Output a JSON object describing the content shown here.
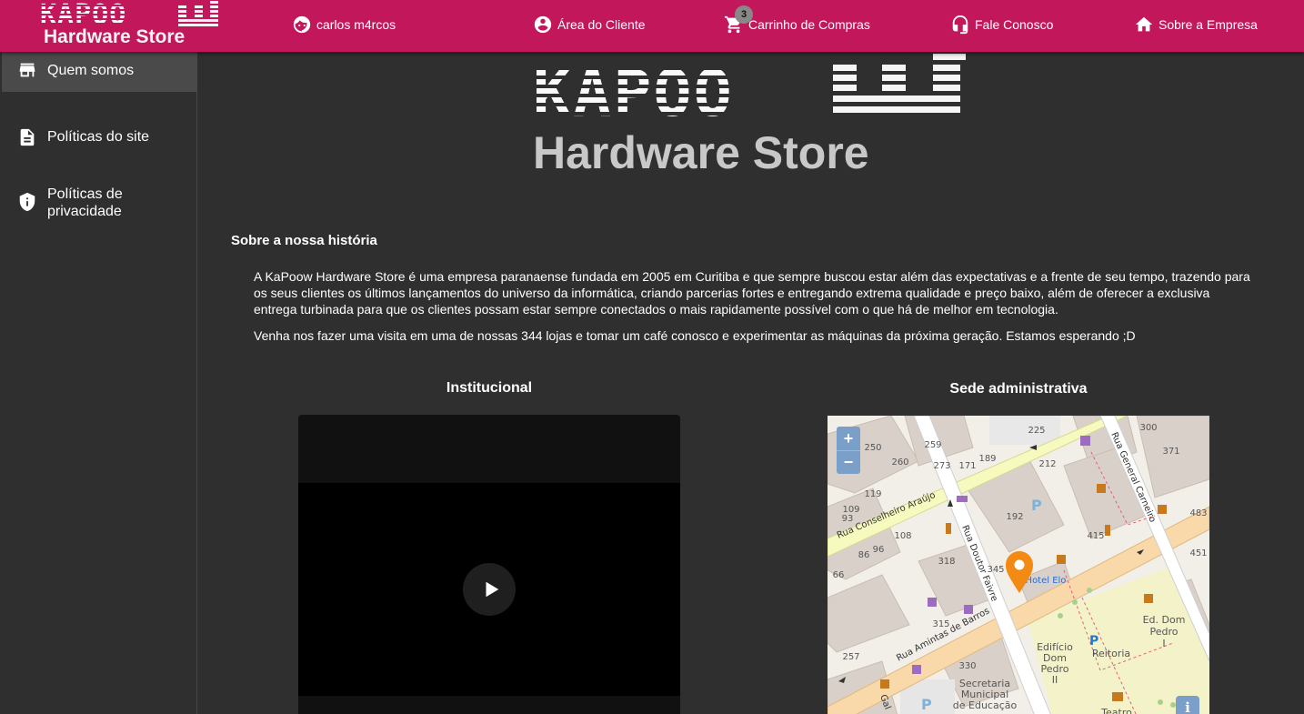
{
  "brand": {
    "logo_top": "KAPOO",
    "logo_bottom": "Hardware Store"
  },
  "nav": {
    "user": "carlos m4rcos",
    "client_area": "Área do Cliente",
    "cart": "Carrinho de Compras",
    "cart_count": "3",
    "contact": "Fale Conosco",
    "about": "Sobre a Empresa"
  },
  "sidebar": {
    "items": [
      {
        "label": "Quem somos",
        "icon": "store-icon"
      },
      {
        "label": "Políticas do site",
        "icon": "document-icon"
      },
      {
        "label": "Políticas de privacidade",
        "icon": "shield-icon"
      }
    ]
  },
  "hero": {
    "logo_top": "KAPOO",
    "logo_bottom": "Hardware Store"
  },
  "about": {
    "title": "Sobre a nossa história",
    "paragraph1": "A KaPoow Hardware Store é uma empresa paranaense fundada em 2005 em Curitiba e que sempre buscou estar além das expectativas e a frente de seu tempo, trazendo para os seus clientes os últimos lançamentos do universo da informática, criando parcerias fortes e entregando extrema qualidade e preço baixo, além de oferecer a exclusiva entrega turbinada para que os clientes possam estar sempre conectados o mais rapidamente possível com o que há de melhor em tecnologia.",
    "paragraph2": "Venha nos fazer uma visita em uma de nossas 344 lojas e tomar um café conosco e experimentar as máquinas da próxima geração. Estamos esperando ;D"
  },
  "institutional": {
    "title": "Institucional"
  },
  "headquarters": {
    "title": "Sede administrativa",
    "zoom_in": "+",
    "zoom_out": "−",
    "info": "i",
    "streets": [
      "Rua Conselheiro Araújo",
      "Rua Doutor Faivre",
      "Rua Amintas de Barros",
      "Rua General Carneiro",
      "Gal"
    ],
    "places": [
      "Hotel Elo",
      "Edifício Dom Pedro II",
      "Reitoria",
      "Ed. Dom Pedro I",
      "Secretaria Municipal de Educação",
      "Teatro"
    ],
    "numbers": [
      "225",
      "300",
      "371",
      "250",
      "259",
      "260",
      "273",
      "171",
      "189",
      "212",
      "119",
      "109",
      "93",
      "192",
      "415",
      "483",
      "108",
      "96",
      "86",
      "66",
      "318",
      "345",
      "451",
      "315",
      "257",
      "330"
    ]
  }
}
